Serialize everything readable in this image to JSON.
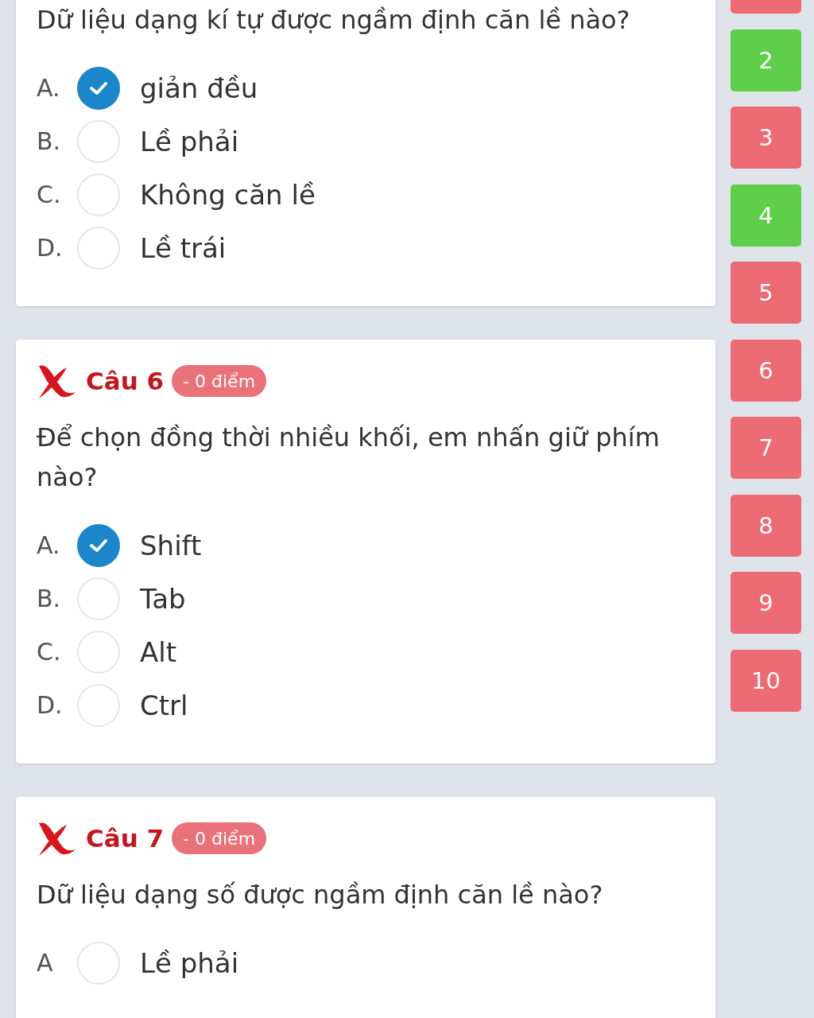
{
  "questions": [
    {
      "text": "Dữ liệu dạng kí tự được ngầm định căn lề nào?",
      "options": [
        {
          "letter": "A.",
          "text": "giản đều",
          "selected": true
        },
        {
          "letter": "B.",
          "text": "Lề phải",
          "selected": false
        },
        {
          "letter": "C.",
          "text": "Không căn lề",
          "selected": false
        },
        {
          "letter": "D.",
          "text": "Lề trái",
          "selected": false
        }
      ]
    },
    {
      "header": {
        "title": "Câu 6",
        "score": "- 0 điểm",
        "correct": false
      },
      "text": "Để chọn đồng thời nhiều khối, em nhấn giữ phím nào?",
      "options": [
        {
          "letter": "A.",
          "text": "Shift",
          "selected": true
        },
        {
          "letter": "B.",
          "text": "Tab",
          "selected": false
        },
        {
          "letter": "C.",
          "text": "Alt",
          "selected": false
        },
        {
          "letter": "D.",
          "text": "Ctrl",
          "selected": false
        }
      ]
    },
    {
      "header": {
        "title": "Câu 7",
        "score": "- 0 điểm",
        "correct": false
      },
      "text": "Dữ liệu dạng số được ngầm định căn lề nào?",
      "options": [
        {
          "letter": "A",
          "text": "Lề phải",
          "selected": false
        }
      ]
    }
  ],
  "question_nav": [
    {
      "correct": false
    },
    {
      "label": "2",
      "correct": true
    },
    {
      "label": "3",
      "correct": false
    },
    {
      "label": "4",
      "correct": true
    },
    {
      "label": "5",
      "correct": false
    },
    {
      "label": "6",
      "correct": false
    },
    {
      "label": "7",
      "correct": false
    },
    {
      "label": "8",
      "correct": false
    },
    {
      "label": "9",
      "correct": false
    },
    {
      "label": "10",
      "correct": false
    }
  ]
}
